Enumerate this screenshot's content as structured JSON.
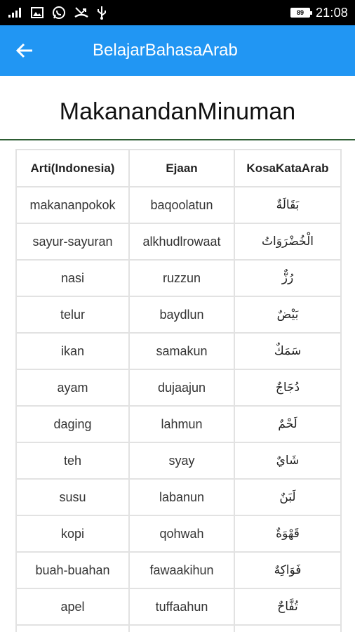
{
  "status_bar": {
    "time": "21:08",
    "battery_level": "89",
    "icons": [
      "signal-icon",
      "image-icon",
      "whatsapp-icon",
      "missed-call-icon",
      "usb-icon",
      "battery-icon"
    ]
  },
  "app_bar": {
    "title": "BelajarBahasaArab",
    "back_icon": "arrow-back-icon",
    "color": "#2196f3"
  },
  "page": {
    "title": "MakanandanMinuman"
  },
  "table": {
    "headers": [
      "Arti(Indonesia)",
      "Ejaan",
      "KosaKataArab"
    ],
    "rows": [
      [
        "makananpokok",
        "baqoolatun",
        "بَقَالَةٌ"
      ],
      [
        "sayur-sayuran",
        "alkhudlrowaat",
        "الْخُضْرَوَاتُ"
      ],
      [
        "nasi",
        "ruzzun",
        "رُزٌّ"
      ],
      [
        "telur",
        "baydlun",
        "بَيْضٌ"
      ],
      [
        "ikan",
        "samakun",
        "سَمَكٌ"
      ],
      [
        "ayam",
        "dujaajun",
        "دُجَاجٌ"
      ],
      [
        "daging",
        "lahmun",
        "لَحْمٌ"
      ],
      [
        "teh",
        "syay",
        "شَايٌ"
      ],
      [
        "susu",
        "labanun",
        "لَبَنٌ"
      ],
      [
        "kopi",
        "qohwah",
        "قَهْوَةٌ"
      ],
      [
        "buah-buahan",
        "fawaakihun",
        "فَوَاكِهٌ"
      ],
      [
        "apel",
        "tuffaahun",
        "تُفَّاحٌ"
      ]
    ]
  }
}
